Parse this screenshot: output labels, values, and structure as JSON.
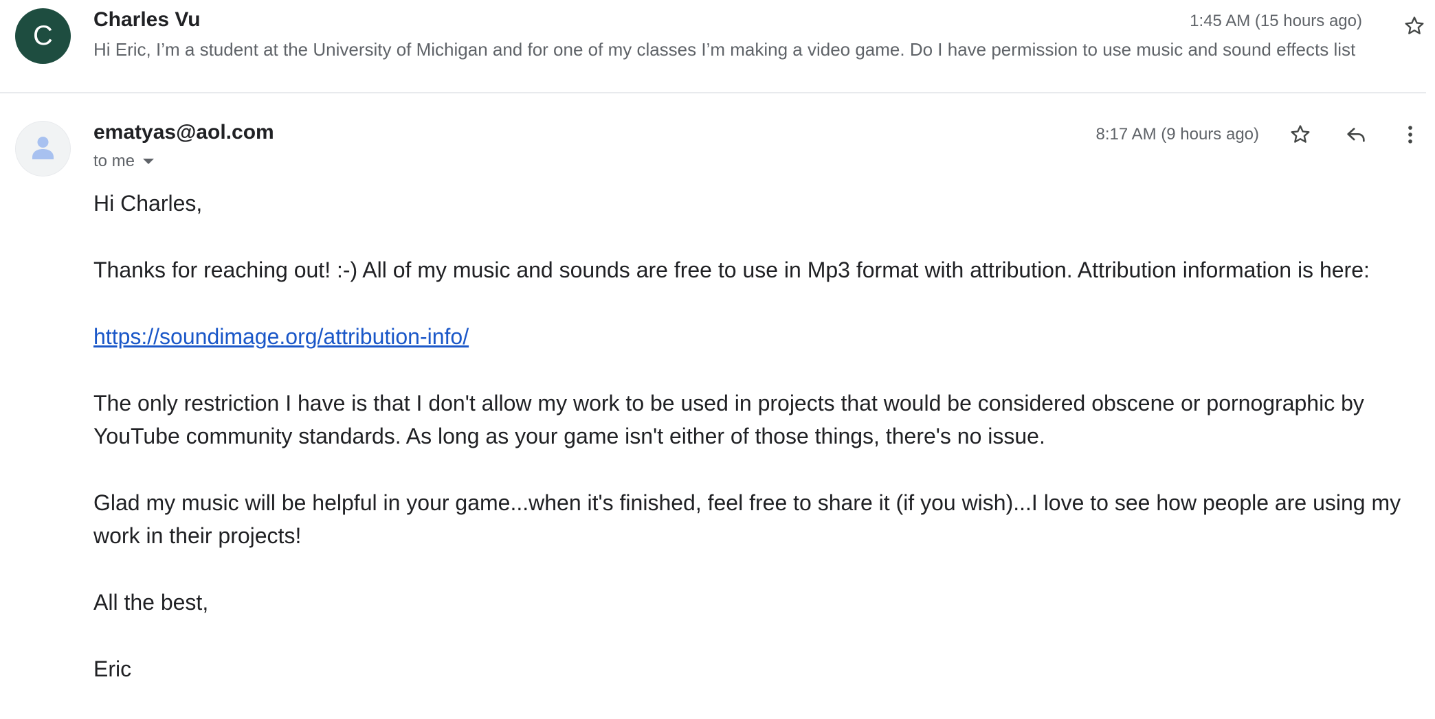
{
  "thread": {
    "collapsed_message": {
      "avatar_letter": "C",
      "avatar_color": "#1e4d40",
      "sender": "Charles Vu",
      "time": "1:45 AM (15 hours ago)",
      "snippet": "Hi Eric, I’m a student at the University of Michigan and for one of my classes I’m making a video game. Do I have permission to use music and sound effects list",
      "star_icon": "star-outline-icon"
    },
    "expanded_message": {
      "avatar_icon": "person-icon",
      "sender_email": "ematyas@aol.com",
      "recipient": "to me",
      "time": "8:17 AM (9 hours ago)",
      "icons": {
        "star": "star-outline-icon",
        "reply": "reply-icon",
        "more": "more-vert-icon"
      },
      "body": {
        "greeting": "Hi Charles,",
        "p1": "Thanks for reaching out! :-) All of my music and sounds are free to use in Mp3 format with attribution. Attribution information is here:",
        "link": "https://soundimage.org/attribution-info/",
        "p2": "The only restriction I have is that I don't allow my work to be used in projects that would be considered obscene or pornographic by YouTube community standards. As long as your game isn't either of those things, there's no issue.",
        "p3": "Glad my music will be helpful in your game...when it's finished, feel free to share it (if you wish)...I love to see how people are using my work in their projects!",
        "closing": "All the best,",
        "signature": "Eric"
      }
    }
  },
  "colors": {
    "link": "#1a57c8",
    "muted_text": "#5f6368",
    "primary_text": "#202124"
  }
}
